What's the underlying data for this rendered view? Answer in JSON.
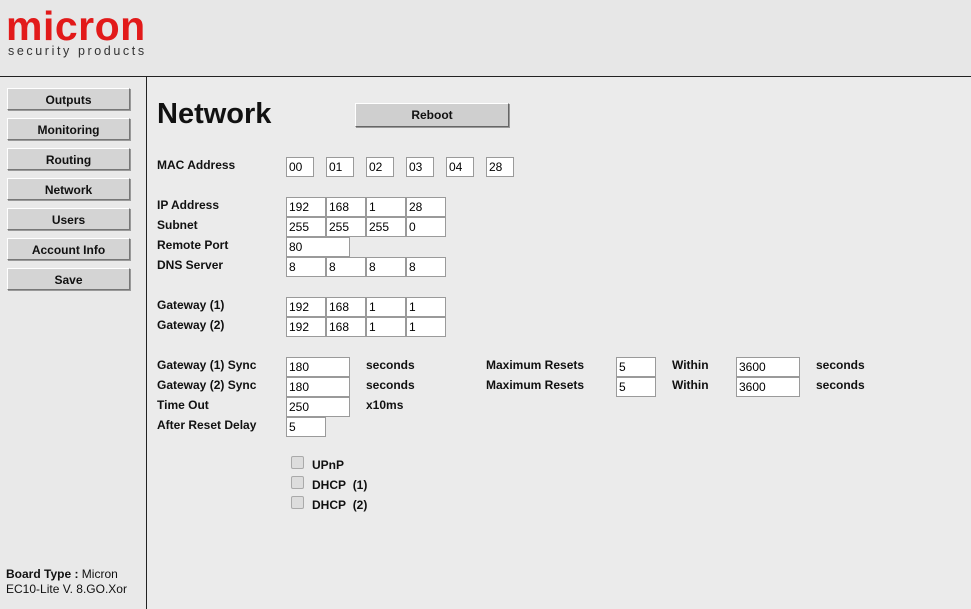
{
  "header": {
    "logo": "micron",
    "tagline": "security products"
  },
  "sidebar": {
    "items": [
      {
        "label": "Outputs"
      },
      {
        "label": "Monitoring"
      },
      {
        "label": "Routing"
      },
      {
        "label": "Network"
      },
      {
        "label": "Users"
      },
      {
        "label": "Account Info"
      },
      {
        "label": "Save"
      }
    ],
    "board_type_label": "Board Type :",
    "board_type_value_1": "Micron",
    "board_type_value_2": "EC10-Lite V. 8.GO.Xor"
  },
  "main": {
    "title": "Network",
    "reboot_label": "Reboot",
    "mac_label": "MAC Address",
    "mac": [
      "00",
      "01",
      "02",
      "03",
      "04",
      "28"
    ],
    "ip_label": "IP Address",
    "ip": [
      "192",
      "168",
      "1",
      "28"
    ],
    "subnet_label": "Subnet",
    "subnet": [
      "255",
      "255",
      "255",
      "0"
    ],
    "remote_port_label": "Remote Port",
    "remote_port": "80",
    "dns_label": "DNS Server",
    "dns": [
      "8",
      "8",
      "8",
      "8"
    ],
    "gw1_label": "Gateway (1)",
    "gw1": [
      "192",
      "168",
      "1",
      "1"
    ],
    "gw2_label": "Gateway (2)",
    "gw2": [
      "192",
      "168",
      "1",
      "1"
    ],
    "gw1_sync_label": "Gateway (1) Sync",
    "gw1_sync": "180",
    "gw2_sync_label": "Gateway (2) Sync",
    "gw2_sync": "180",
    "seconds_label": "seconds",
    "max_resets_label": "Maximum Resets",
    "max_resets_1": "5",
    "max_resets_2": "5",
    "within_label": "Within",
    "within_1": "3600",
    "within_2": "3600",
    "timeout_label": "Time Out",
    "timeout": "250",
    "timeout_unit": "x10ms",
    "reset_delay_label": "After Reset Delay",
    "reset_delay": "5",
    "upnp_label": "UPnP",
    "dhcp1_label": "DHCP",
    "dhcp1_num": "(1)",
    "dhcp2_label": "DHCP",
    "dhcp2_num": "(2)"
  }
}
